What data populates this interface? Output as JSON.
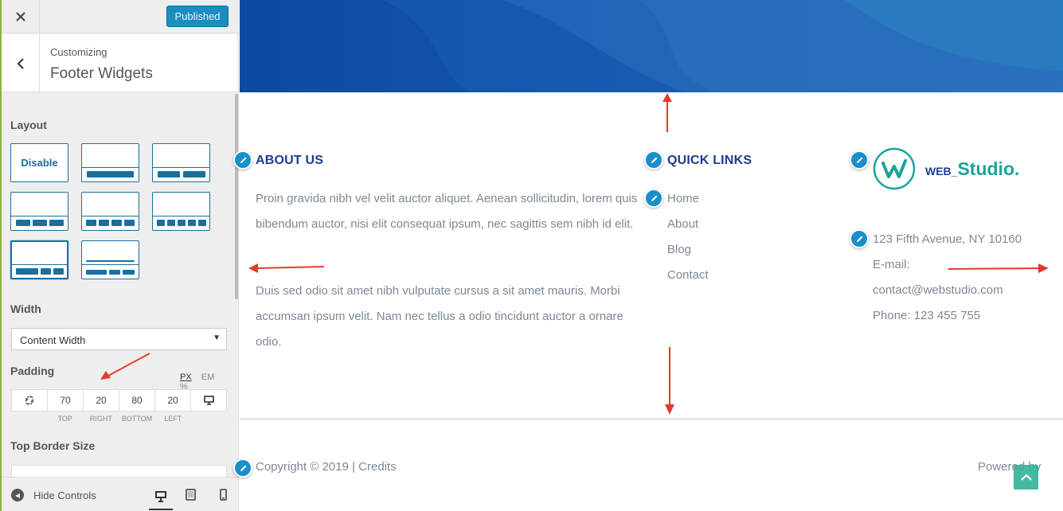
{
  "sidebar": {
    "close_icon": "close-icon",
    "publish_label": "Published",
    "breadcrumb": "Customizing",
    "section_title": "Footer Widgets",
    "layout_label": "Layout",
    "disable_label": "Disable",
    "width_label": "Width",
    "width_value": "Content Width",
    "padding_label": "Padding",
    "units": [
      "PX",
      "EM",
      "%"
    ],
    "padding": {
      "top": "70",
      "right": "20",
      "bottom": "80",
      "left": "20"
    },
    "padding_sublabels": [
      "TOP",
      "RIGHT",
      "BOTTOM",
      "LEFT"
    ],
    "top_border_label": "Top Border Size",
    "hide_controls_label": "Hide Controls"
  },
  "preview": {
    "about_title": "ABOUT US",
    "about_p1": "Proin gravida nibh vel velit auctor aliquet. Aenean sollicitudin, lorem quis bibendum auctor, nisi elit consequat ipsum, nec sagittis sem nibh id elit.",
    "about_p2": "Duis sed odio sit amet nibh vulputate cursus a sit amet mauris. Morbi accumsan ipsum velit. Nam nec tellus a odio tincidunt auctor a ornare odio.",
    "links_title": "QUICK LINKS",
    "links": [
      "Home",
      "About",
      "Blog",
      "Contact"
    ],
    "logo_small": "WEB_",
    "logo_big": "Studio.",
    "address": "123 Fifth Avenue, NY 10160",
    "email_label": "E-mail:",
    "email": "contact@webstudio.com",
    "phone": "Phone: 123 455 755",
    "copyright": "Copyright © 2019 | Credits",
    "powered": "Powered by"
  },
  "colors": {
    "accent": "#1a6fa0",
    "publish": "#1e8cbe",
    "title_blue": "#1a3d8f",
    "logo_teal": "#1aa39a",
    "arrow_red": "#e53b2c"
  }
}
